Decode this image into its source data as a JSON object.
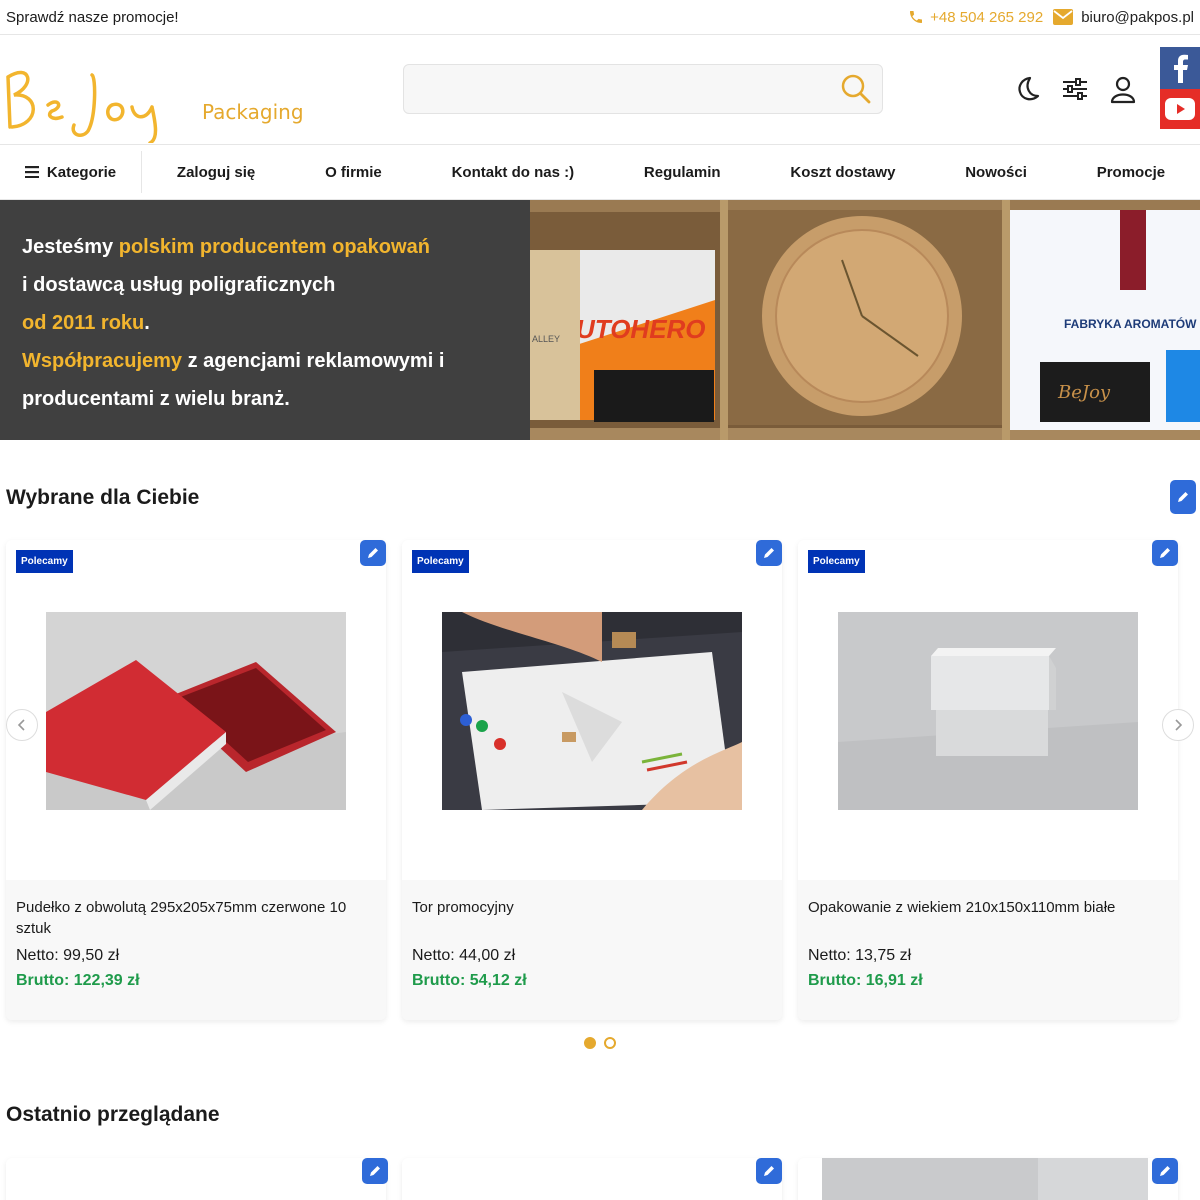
{
  "topbar": {
    "promo_text": "Sprawdź nasze promocje!",
    "phone": "+48 504 265 292",
    "email": "biuro@pakpos.pl"
  },
  "header": {
    "logo_script": "BeJoy",
    "logo_sub": "Packaging",
    "search_placeholder": "",
    "icons": [
      "moon-icon",
      "filters-icon",
      "user-icon"
    ],
    "social": [
      "facebook-icon",
      "youtube-icon"
    ]
  },
  "nav": {
    "categories_label": "Kategorie",
    "items": [
      "Zaloguj się",
      "O firmie",
      "Kontakt do nas :)",
      "Regulamin",
      "Koszt dostawy",
      "Nowości",
      "Promocje"
    ]
  },
  "banner": {
    "line1_a": "Jesteśmy ",
    "line1_b": "polskim producentem opakowań",
    "line2": "i dostawcą usług poligraficznych",
    "line3_a": "od 2011 roku",
    "line3_b": ".",
    "line4_a": "Współpracujemy",
    "line4_b": " z agencjami reklamowymi i",
    "line5": "producentami z wielu branż.",
    "img_text_1": "UTOHERO",
    "img_text_2": "FABRYKA AROMATÓW",
    "img_text_3": "ALLEY",
    "img_logo": "BeJoy"
  },
  "featured": {
    "title": "Wybrane dla Ciebie",
    "products": [
      {
        "badge": "Polecamy",
        "name": "Pudełko z obwolutą 295x205x75mm czerwone 10 sztuk",
        "net": "Netto: 99,50 zł",
        "gross": "Brutto: 122,39 zł"
      },
      {
        "badge": "Polecamy",
        "name": "Tor promocyjny",
        "net": "Netto: 44,00 zł",
        "gross": "Brutto: 54,12 zł"
      },
      {
        "badge": "Polecamy",
        "name": "Opakowanie z wiekiem 210x150x110mm białe",
        "net": "Netto: 13,75 zł",
        "gross": "Brutto: 16,91 zł"
      }
    ],
    "pages": 2,
    "active_page": 1
  },
  "recent": {
    "title": "Ostatnio przeglądane"
  },
  "colors": {
    "accent": "#e5a92e",
    "price_green": "#1f9b4b",
    "badge_blue": "#0033b5",
    "edit_blue": "#2f6bd9",
    "banner_bg": "#404040"
  }
}
